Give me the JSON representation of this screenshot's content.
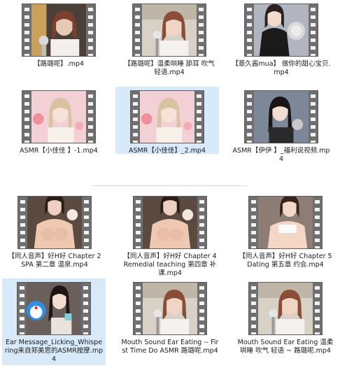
{
  "group1": {
    "files": [
      {
        "name": "【路璐呢】.mp4",
        "selected": false,
        "scene": "desk-mic"
      },
      {
        "name": "【路璐呢】温柔哄睡 舔耳 吹气 轻语.mp4",
        "selected": false,
        "scene": "girl-mic"
      },
      {
        "name": "【薏久酱mua】 做你的甜心宝贝.mp4",
        "selected": false,
        "scene": "dark-dress"
      },
      {
        "name": "ASMR【小佳佳 】-1.mp4",
        "selected": false,
        "scene": "pink-room"
      },
      {
        "name": "ASMR【小佳佳】_2.mp4",
        "selected": true,
        "scene": "pink-room"
      },
      {
        "name": "ASMR【伊伊 】_福利说视频.mp4",
        "selected": false,
        "scene": "dark-hair"
      }
    ]
  },
  "group2": {
    "files": [
      {
        "name": "【同人音声】好H好 Chapter 2 SPA 第二章 温泉.mp4",
        "selected": false,
        "scene": "skin"
      },
      {
        "name": "【同人音声】好H好 Chapter 4 Remedial teaching 第四章 补课.mp4",
        "selected": false,
        "scene": "skin"
      },
      {
        "name": "【同人音声】好H好 Chapter 5 Dating 第五章 约会.mp4",
        "selected": false,
        "scene": "skin-light"
      },
      {
        "name": "Ear Message_Licking_Whispering来自郑美思的ASMR按摩.mp4",
        "selected": true,
        "scene": "blue-toy"
      },
      {
        "name": "Mouth Sound Ear Eating -- First Time Do ASMR 路璐呢.mp4",
        "selected": false,
        "scene": "girl-mic"
      },
      {
        "name": "Mouth Sound Ear Eating 温柔哄睡 吹气 轻语 ~ 路璐呢.mp4",
        "selected": false,
        "scene": "girl-mic"
      }
    ]
  }
}
